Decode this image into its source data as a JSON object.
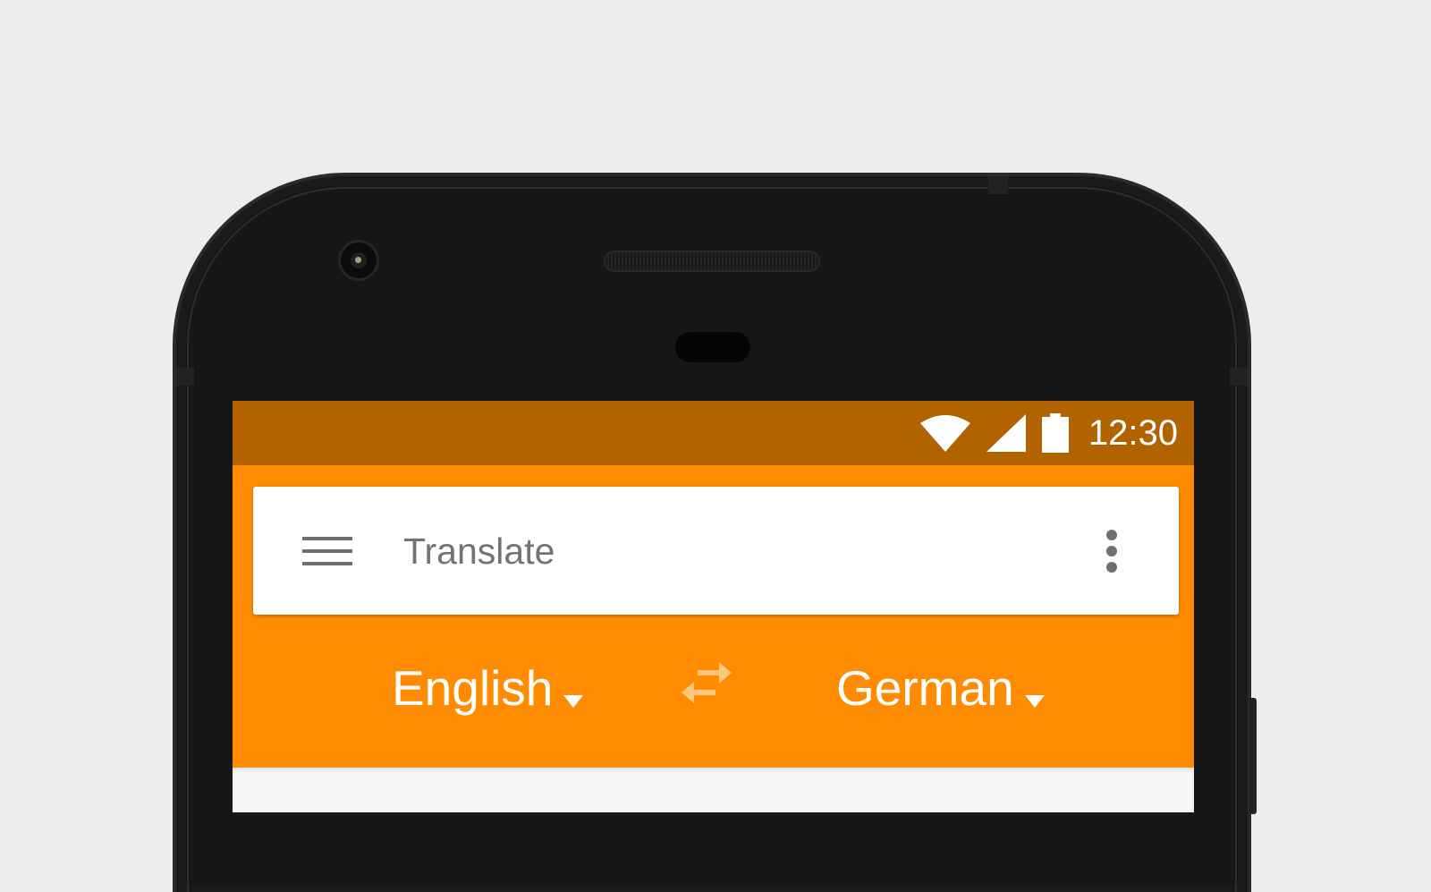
{
  "status_bar": {
    "time": "12:30",
    "icons": [
      "wifi-icon",
      "cellular-signal-icon",
      "battery-icon"
    ]
  },
  "search_bar": {
    "title": "Translate",
    "menu_icon": "hamburger-menu-icon",
    "overflow_icon": "more-vert-icon"
  },
  "languages": {
    "source": "English",
    "target": "German",
    "swap_icon": "swap-horiz-icon",
    "dropdown_icon": "arrow-drop-down-icon"
  },
  "colors": {
    "status_bar": "#b36200",
    "app_bar": "#ff8c00",
    "card": "#ffffff",
    "title_text": "#737373",
    "icon_grey": "#6f6f6f",
    "swap_icon": "#ffc680",
    "page_background": "#ecedef",
    "device_body": "#161616"
  }
}
